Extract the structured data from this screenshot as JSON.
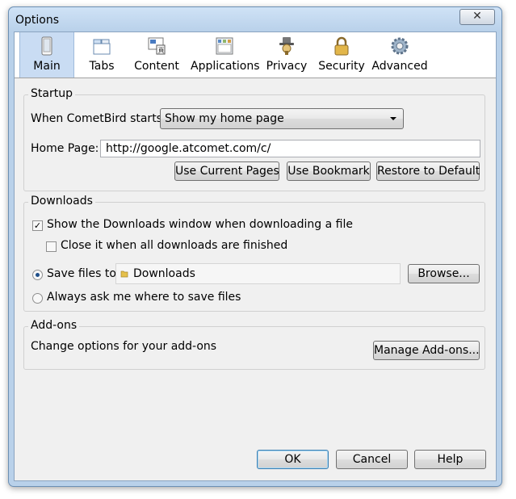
{
  "window": {
    "title": "Options",
    "close_glyph": "✕"
  },
  "toolbar": {
    "tabs": [
      {
        "label": "Main",
        "icon": "main-icon",
        "selected": true
      },
      {
        "label": "Tabs",
        "icon": "tabs-icon",
        "selected": false
      },
      {
        "label": "Content",
        "icon": "content-icon",
        "selected": false
      },
      {
        "label": "Applications",
        "icon": "applications-icon",
        "selected": false
      },
      {
        "label": "Privacy",
        "icon": "privacy-icon",
        "selected": false
      },
      {
        "label": "Security",
        "icon": "security-icon",
        "selected": false
      },
      {
        "label": "Advanced",
        "icon": "advanced-icon",
        "selected": false
      }
    ]
  },
  "startup": {
    "group_label": "Startup",
    "when_starts_label": "When CometBird starts:",
    "when_starts_value": "Show my home page",
    "home_page_label": "Home Page:",
    "home_page_value": "http://google.atcomet.com/c/",
    "use_current_pages": "Use Current Pages",
    "use_bookmark": "Use Bookmark",
    "restore_default": "Restore to Default"
  },
  "downloads": {
    "group_label": "Downloads",
    "show_window_label": "Show the Downloads window when downloading a file",
    "show_window_checked": true,
    "close_it_label": "Close it when all downloads are finished",
    "close_it_checked": false,
    "save_files_label": "Save files to",
    "save_folder": "Downloads",
    "browse_label": "Browse...",
    "always_ask_label": "Always ask me where to save files",
    "save_files_selected": true
  },
  "addons": {
    "group_label": "Add-ons",
    "description": "Change options for your add-ons",
    "manage_label": "Manage Add-ons..."
  },
  "footer": {
    "ok": "OK",
    "cancel": "Cancel",
    "help": "Help"
  },
  "colors": {
    "window_frame": "#b9d1ea",
    "selected_tab": "#c9dcf3",
    "dialog_bg": "#f0f0f0"
  }
}
